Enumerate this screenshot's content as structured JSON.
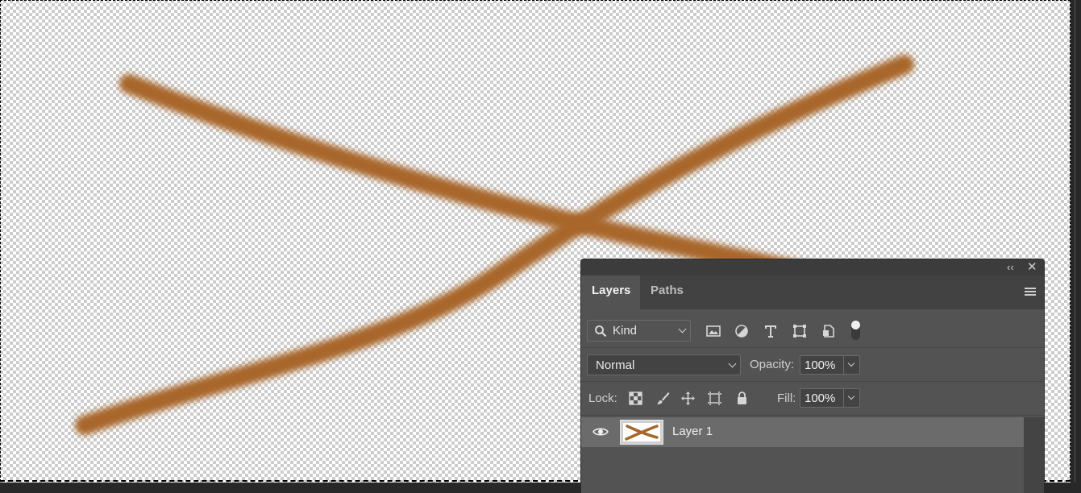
{
  "canvas": {
    "stroke_color": "#a8662a"
  },
  "panel": {
    "collapse_glyph": "‹‹",
    "close_glyph": "✕",
    "tabs": [
      {
        "label": "Layers",
        "active": true
      },
      {
        "label": "Paths",
        "active": false
      }
    ],
    "filter": {
      "kind_label": "Kind",
      "filter_icons": [
        "image-filter-icon",
        "adjustment-filter-icon",
        "type-filter-icon",
        "shape-filter-icon",
        "smart-object-filter-icon"
      ],
      "filter_toggle": "on"
    },
    "blend_mode": "Normal",
    "opacity_label": "Opacity:",
    "opacity_value": "100%",
    "lock_label": "Lock:",
    "lock_icons": [
      "lock-transparent-pixels-icon",
      "lock-image-pixels-icon",
      "lock-position-icon",
      "lock-artboard-icon",
      "lock-all-icon"
    ],
    "fill_label": "Fill:",
    "fill_value": "100%",
    "layers": [
      {
        "name": "Layer 1",
        "visible": true,
        "selected": true
      }
    ]
  },
  "colors": {
    "panel_bg": "#535353",
    "selected_layer": "#6b6b6b",
    "brush_stroke": "#a8662a"
  }
}
